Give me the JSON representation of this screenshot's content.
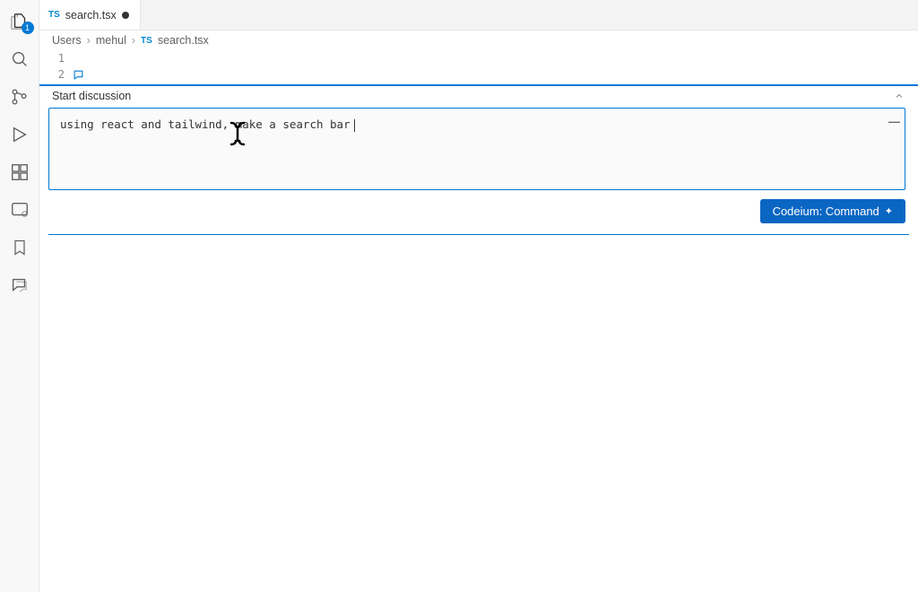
{
  "activity_bar": {
    "explorer_badge": "1"
  },
  "tab": {
    "lang": "TS",
    "filename": "search.tsx"
  },
  "breadcrumb": {
    "parts": [
      "Users",
      "mehul"
    ],
    "lang": "TS",
    "file": "search.tsx"
  },
  "editor": {
    "line1": "1",
    "line2": "2"
  },
  "discussion": {
    "title": "Start discussion",
    "input_value": "using react and tailwind, make a search bar",
    "command_button": "Codeium: Command"
  }
}
